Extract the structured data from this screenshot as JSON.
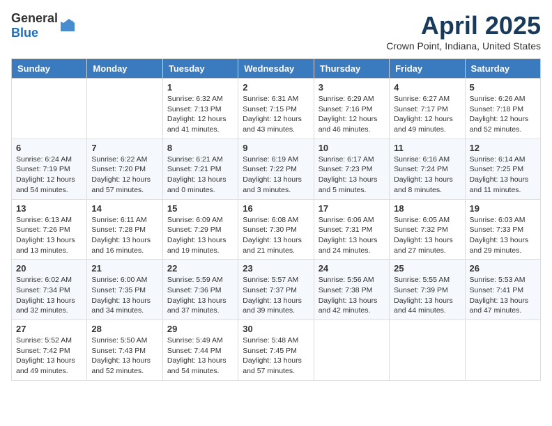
{
  "header": {
    "logo_general": "General",
    "logo_blue": "Blue",
    "month_title": "April 2025",
    "subtitle": "Crown Point, Indiana, United States"
  },
  "days_of_week": [
    "Sunday",
    "Monday",
    "Tuesday",
    "Wednesday",
    "Thursday",
    "Friday",
    "Saturday"
  ],
  "weeks": [
    [
      {
        "day": "",
        "info": ""
      },
      {
        "day": "",
        "info": ""
      },
      {
        "day": "1",
        "info": "Sunrise: 6:32 AM\nSunset: 7:13 PM\nDaylight: 12 hours and 41 minutes."
      },
      {
        "day": "2",
        "info": "Sunrise: 6:31 AM\nSunset: 7:15 PM\nDaylight: 12 hours and 43 minutes."
      },
      {
        "day": "3",
        "info": "Sunrise: 6:29 AM\nSunset: 7:16 PM\nDaylight: 12 hours and 46 minutes."
      },
      {
        "day": "4",
        "info": "Sunrise: 6:27 AM\nSunset: 7:17 PM\nDaylight: 12 hours and 49 minutes."
      },
      {
        "day": "5",
        "info": "Sunrise: 6:26 AM\nSunset: 7:18 PM\nDaylight: 12 hours and 52 minutes."
      }
    ],
    [
      {
        "day": "6",
        "info": "Sunrise: 6:24 AM\nSunset: 7:19 PM\nDaylight: 12 hours and 54 minutes."
      },
      {
        "day": "7",
        "info": "Sunrise: 6:22 AM\nSunset: 7:20 PM\nDaylight: 12 hours and 57 minutes."
      },
      {
        "day": "8",
        "info": "Sunrise: 6:21 AM\nSunset: 7:21 PM\nDaylight: 13 hours and 0 minutes."
      },
      {
        "day": "9",
        "info": "Sunrise: 6:19 AM\nSunset: 7:22 PM\nDaylight: 13 hours and 3 minutes."
      },
      {
        "day": "10",
        "info": "Sunrise: 6:17 AM\nSunset: 7:23 PM\nDaylight: 13 hours and 5 minutes."
      },
      {
        "day": "11",
        "info": "Sunrise: 6:16 AM\nSunset: 7:24 PM\nDaylight: 13 hours and 8 minutes."
      },
      {
        "day": "12",
        "info": "Sunrise: 6:14 AM\nSunset: 7:25 PM\nDaylight: 13 hours and 11 minutes."
      }
    ],
    [
      {
        "day": "13",
        "info": "Sunrise: 6:13 AM\nSunset: 7:26 PM\nDaylight: 13 hours and 13 minutes."
      },
      {
        "day": "14",
        "info": "Sunrise: 6:11 AM\nSunset: 7:28 PM\nDaylight: 13 hours and 16 minutes."
      },
      {
        "day": "15",
        "info": "Sunrise: 6:09 AM\nSunset: 7:29 PM\nDaylight: 13 hours and 19 minutes."
      },
      {
        "day": "16",
        "info": "Sunrise: 6:08 AM\nSunset: 7:30 PM\nDaylight: 13 hours and 21 minutes."
      },
      {
        "day": "17",
        "info": "Sunrise: 6:06 AM\nSunset: 7:31 PM\nDaylight: 13 hours and 24 minutes."
      },
      {
        "day": "18",
        "info": "Sunrise: 6:05 AM\nSunset: 7:32 PM\nDaylight: 13 hours and 27 minutes."
      },
      {
        "day": "19",
        "info": "Sunrise: 6:03 AM\nSunset: 7:33 PM\nDaylight: 13 hours and 29 minutes."
      }
    ],
    [
      {
        "day": "20",
        "info": "Sunrise: 6:02 AM\nSunset: 7:34 PM\nDaylight: 13 hours and 32 minutes."
      },
      {
        "day": "21",
        "info": "Sunrise: 6:00 AM\nSunset: 7:35 PM\nDaylight: 13 hours and 34 minutes."
      },
      {
        "day": "22",
        "info": "Sunrise: 5:59 AM\nSunset: 7:36 PM\nDaylight: 13 hours and 37 minutes."
      },
      {
        "day": "23",
        "info": "Sunrise: 5:57 AM\nSunset: 7:37 PM\nDaylight: 13 hours and 39 minutes."
      },
      {
        "day": "24",
        "info": "Sunrise: 5:56 AM\nSunset: 7:38 PM\nDaylight: 13 hours and 42 minutes."
      },
      {
        "day": "25",
        "info": "Sunrise: 5:55 AM\nSunset: 7:39 PM\nDaylight: 13 hours and 44 minutes."
      },
      {
        "day": "26",
        "info": "Sunrise: 5:53 AM\nSunset: 7:41 PM\nDaylight: 13 hours and 47 minutes."
      }
    ],
    [
      {
        "day": "27",
        "info": "Sunrise: 5:52 AM\nSunset: 7:42 PM\nDaylight: 13 hours and 49 minutes."
      },
      {
        "day": "28",
        "info": "Sunrise: 5:50 AM\nSunset: 7:43 PM\nDaylight: 13 hours and 52 minutes."
      },
      {
        "day": "29",
        "info": "Sunrise: 5:49 AM\nSunset: 7:44 PM\nDaylight: 13 hours and 54 minutes."
      },
      {
        "day": "30",
        "info": "Sunrise: 5:48 AM\nSunset: 7:45 PM\nDaylight: 13 hours and 57 minutes."
      },
      {
        "day": "",
        "info": ""
      },
      {
        "day": "",
        "info": ""
      },
      {
        "day": "",
        "info": ""
      }
    ]
  ]
}
